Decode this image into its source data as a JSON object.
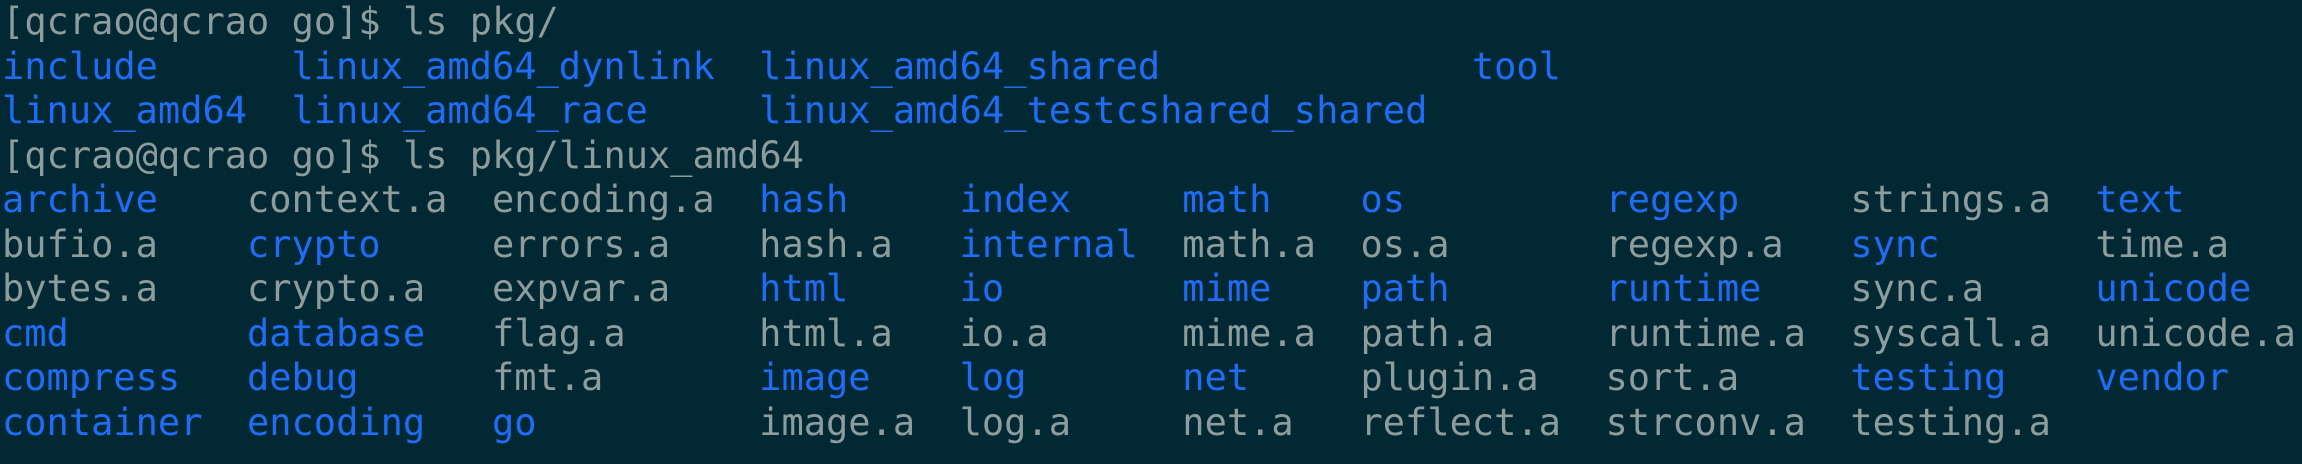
{
  "terminal": {
    "colors": {
      "background": "#022833",
      "text": "#8d9c9c",
      "directory": "#1f6cf5"
    },
    "blocks": [
      {
        "prompt": "[qcrao@qcrao go]$ ls pkg/",
        "rows": 2,
        "entries": [
          {
            "name": "include",
            "dir": true
          },
          {
            "name": "linux_amd64",
            "dir": true
          },
          {
            "name": "linux_amd64_dynlink",
            "dir": true
          },
          {
            "name": "linux_amd64_race",
            "dir": true
          },
          {
            "name": "linux_amd64_shared",
            "dir": true
          },
          {
            "name": "linux_amd64_testcshared_shared",
            "dir": true
          },
          {
            "name": "tool",
            "dir": true
          }
        ]
      },
      {
        "prompt": "[qcrao@qcrao go]$ ls pkg/linux_amd64",
        "rows": 6,
        "entries": [
          {
            "name": "archive",
            "dir": true
          },
          {
            "name": "bufio.a",
            "dir": false
          },
          {
            "name": "bytes.a",
            "dir": false
          },
          {
            "name": "cmd",
            "dir": true
          },
          {
            "name": "compress",
            "dir": true
          },
          {
            "name": "container",
            "dir": true
          },
          {
            "name": "context.a",
            "dir": false
          },
          {
            "name": "crypto",
            "dir": true
          },
          {
            "name": "crypto.a",
            "dir": false
          },
          {
            "name": "database",
            "dir": true
          },
          {
            "name": "debug",
            "dir": true
          },
          {
            "name": "encoding",
            "dir": true
          },
          {
            "name": "encoding.a",
            "dir": false
          },
          {
            "name": "errors.a",
            "dir": false
          },
          {
            "name": "expvar.a",
            "dir": false
          },
          {
            "name": "flag.a",
            "dir": false
          },
          {
            "name": "fmt.a",
            "dir": false
          },
          {
            "name": "go",
            "dir": true
          },
          {
            "name": "hash",
            "dir": true
          },
          {
            "name": "hash.a",
            "dir": false
          },
          {
            "name": "html",
            "dir": true
          },
          {
            "name": "html.a",
            "dir": false
          },
          {
            "name": "image",
            "dir": true
          },
          {
            "name": "image.a",
            "dir": false
          },
          {
            "name": "index",
            "dir": true
          },
          {
            "name": "internal",
            "dir": true
          },
          {
            "name": "io",
            "dir": true
          },
          {
            "name": "io.a",
            "dir": false
          },
          {
            "name": "log",
            "dir": true
          },
          {
            "name": "log.a",
            "dir": false
          },
          {
            "name": "math",
            "dir": true
          },
          {
            "name": "math.a",
            "dir": false
          },
          {
            "name": "mime",
            "dir": true
          },
          {
            "name": "mime.a",
            "dir": false
          },
          {
            "name": "net",
            "dir": true
          },
          {
            "name": "net.a",
            "dir": false
          },
          {
            "name": "os",
            "dir": true
          },
          {
            "name": "os.a",
            "dir": false
          },
          {
            "name": "path",
            "dir": true
          },
          {
            "name": "path.a",
            "dir": false
          },
          {
            "name": "plugin.a",
            "dir": false
          },
          {
            "name": "reflect.a",
            "dir": false
          },
          {
            "name": "regexp",
            "dir": true
          },
          {
            "name": "regexp.a",
            "dir": false
          },
          {
            "name": "runtime",
            "dir": true
          },
          {
            "name": "runtime.a",
            "dir": false
          },
          {
            "name": "sort.a",
            "dir": false
          },
          {
            "name": "strconv.a",
            "dir": false
          },
          {
            "name": "strings.a",
            "dir": false
          },
          {
            "name": "sync",
            "dir": true
          },
          {
            "name": "sync.a",
            "dir": false
          },
          {
            "name": "syscall.a",
            "dir": false
          },
          {
            "name": "testing",
            "dir": true
          },
          {
            "name": "testing.a",
            "dir": false
          },
          {
            "name": "text",
            "dir": true
          },
          {
            "name": "time.a",
            "dir": false
          },
          {
            "name": "unicode",
            "dir": true
          },
          {
            "name": "unicode.a",
            "dir": false
          },
          {
            "name": "vendor",
            "dir": true
          }
        ]
      }
    ]
  }
}
